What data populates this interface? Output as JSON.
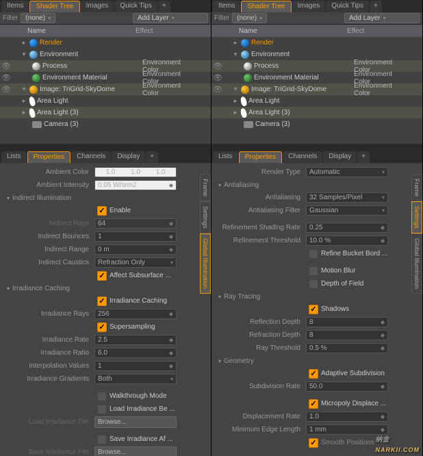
{
  "tabs": {
    "items": "Items",
    "shader": "Shader Tree",
    "images": "Images",
    "tips": "Quick Tips",
    "plus": "+"
  },
  "filter": {
    "label": "Filter",
    "value": "(none)",
    "add": "Add Layer"
  },
  "tree_header": {
    "name": "Name",
    "effect": "Effect"
  },
  "tree": {
    "render": "Render",
    "env": "Environment",
    "proc": "Process",
    "mat": "Environment Material",
    "img": "Image: TriGrid-SkyDome",
    "light1": "Area Light",
    "light3": "Area Light (3)",
    "cam": "Camera (3)",
    "effect": "Environment Color"
  },
  "lower_tabs": {
    "lists": "Lists",
    "props": "Properties",
    "channels": "Channels",
    "display": "Display",
    "plus": "+"
  },
  "side": {
    "frame": "Frame",
    "settings": "Settings",
    "gi": "Global Illumination"
  },
  "left": {
    "ambient_color": "Ambient Color",
    "ambient_color_val": [
      "1.0",
      "1.0",
      "1.0"
    ],
    "ambient_intensity": "Ambient Intensity",
    "ambient_intensity_val": "0.05 W/srm2",
    "sec_indirect": "Indirect Illumination",
    "enable": "Enable",
    "indirect_rays": "Indirect Rays",
    "indirect_rays_val": "64",
    "indirect_bounces": "Indirect Bounces",
    "indirect_bounces_val": "1",
    "indirect_range": "Indirect Range",
    "indirect_range_val": "0 m",
    "indirect_caustics": "Indirect Caustics",
    "indirect_caustics_val": "Refraction Only",
    "affect_sss": "Affect Subsurface ...",
    "sec_irrad": "Irradiance Caching",
    "irrad_cache": "Irradiance Caching",
    "irrad_rays": "Irradiance Rays",
    "irrad_rays_val": "256",
    "supersampling": "Supersampling",
    "irrad_rate": "Irradiance Rate",
    "irrad_rate_val": "2.5",
    "irrad_ratio": "Irradiance Ratio",
    "irrad_ratio_val": "6.0",
    "interp_vals": "Interpolation Values",
    "interp_vals_val": "1",
    "irrad_grad": "Irradiance Gradients",
    "irrad_grad_val": "Both",
    "walkthrough": "Walkthrough Mode",
    "load_irrad_be": "Load Irradiance Be ...",
    "load_file": "Load Irradiance File",
    "browse": "Browse...",
    "save_irrad_af": "Save Irradiance Af ...",
    "save_file": "Save Irradiance File"
  },
  "right": {
    "render_type": "Render Type",
    "render_type_val": "Automatic",
    "sec_aa": "Antialiasing",
    "aa": "Antialiasing",
    "aa_val": "32 Samples/Pixel",
    "aa_filter": "Antialiasing Filter",
    "aa_filter_val": "Gaussian",
    "refine_rate": "Refinement Shading Rate",
    "refine_rate_val": "0.25",
    "refine_thresh": "Refinement Threshold",
    "refine_thresh_val": "10.0 %",
    "refine_bucket": "Refine Bucket Bord ...",
    "motion_blur": "Motion Blur",
    "dof": "Depth of Field",
    "sec_ray": "Ray Tracing",
    "shadows": "Shadows",
    "refl_depth": "Reflection Depth",
    "refl_depth_val": "8",
    "refr_depth": "Refraction Depth",
    "refr_depth_val": "8",
    "ray_thresh": "Ray Threshold",
    "ray_thresh_val": "0.5 %",
    "sec_geom": "Geometry",
    "adaptive": "Adaptive Subdivision",
    "subdiv_rate": "Subdivision Rate",
    "subdiv_rate_val": "50.0",
    "micropoly": "Micropoly Displace ...",
    "disp_rate": "Displacement Rate",
    "disp_rate_val": "1.0",
    "min_edge": "Minimum Edge Length",
    "min_edge_val": "1 mm",
    "smooth": "Smooth Positions"
  },
  "watermark": {
    "main": "纳金",
    "sub": "NARKII.COM"
  }
}
